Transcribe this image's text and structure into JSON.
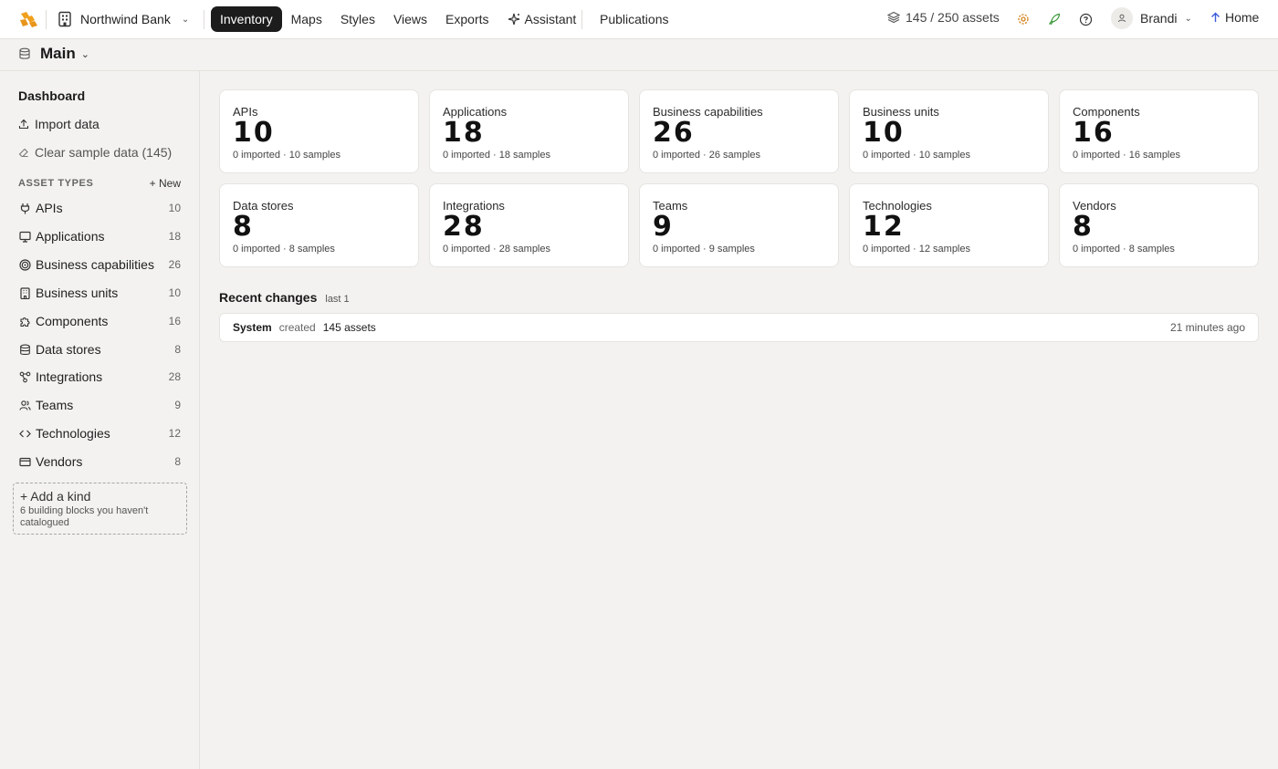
{
  "topbar": {
    "org_name": "Northwind Bank",
    "nav": [
      {
        "label": "Inventory",
        "active": true
      },
      {
        "label": "Maps"
      },
      {
        "label": "Styles"
      },
      {
        "label": "Views"
      },
      {
        "label": "Exports"
      },
      {
        "label": "Assistant",
        "icon": "sparkles-icon"
      }
    ],
    "publications": "Publications",
    "assets_count": "145 / 250 assets",
    "user_name": "Brandi",
    "home_label": "Home",
    "colors": {
      "accent": "#f0a01c",
      "gear": "#d4821a",
      "rocket": "#3a9a3a"
    }
  },
  "workspace": {
    "name": "Main"
  },
  "sidebar": {
    "dashboard": "Dashboard",
    "import": "Import data",
    "clear": "Clear sample data (145)",
    "asset_types_heading": "ASSET TYPES",
    "new_label": "+ New",
    "items": [
      {
        "label": "APIs",
        "count": "10",
        "icon": "plug-icon"
      },
      {
        "label": "Applications",
        "count": "18",
        "icon": "monitor-icon"
      },
      {
        "label": "Business capabilities",
        "count": "26",
        "icon": "target-icon"
      },
      {
        "label": "Business units",
        "count": "10",
        "icon": "building-icon"
      },
      {
        "label": "Components",
        "count": "16",
        "icon": "puzzle-icon"
      },
      {
        "label": "Data stores",
        "count": "8",
        "icon": "database-icon"
      },
      {
        "label": "Integrations",
        "count": "28",
        "icon": "workflow-icon"
      },
      {
        "label": "Teams",
        "count": "9",
        "icon": "users-icon"
      },
      {
        "label": "Technologies",
        "count": "12",
        "icon": "code-icon"
      },
      {
        "label": "Vendors",
        "count": "8",
        "icon": "card-icon"
      }
    ],
    "add_kind_title": "+ Add a kind",
    "add_kind_sub": "6 building blocks you haven't catalogued"
  },
  "cards": [
    {
      "name": "APIs",
      "count": "10",
      "sub": "0 imported · 10 samples"
    },
    {
      "name": "Applications",
      "count": "18",
      "sub": "0 imported · 18 samples"
    },
    {
      "name": "Business capabilities",
      "count": "26",
      "sub": "0 imported · 26 samples"
    },
    {
      "name": "Business units",
      "count": "10",
      "sub": "0 imported · 10 samples"
    },
    {
      "name": "Components",
      "count": "16",
      "sub": "0 imported · 16 samples"
    },
    {
      "name": "Data stores",
      "count": "8",
      "sub": "0 imported · 8 samples"
    },
    {
      "name": "Integrations",
      "count": "28",
      "sub": "0 imported · 28 samples"
    },
    {
      "name": "Teams",
      "count": "9",
      "sub": "0 imported · 9 samples"
    },
    {
      "name": "Technologies",
      "count": "12",
      "sub": "0 imported · 12 samples"
    },
    {
      "name": "Vendors",
      "count": "8",
      "sub": "0 imported · 8 samples"
    }
  ],
  "recent": {
    "title": "Recent changes",
    "subtitle": "last 1",
    "rows": [
      {
        "who": "System",
        "action": "created",
        "object": "145 assets",
        "when": "21 minutes ago"
      }
    ]
  }
}
